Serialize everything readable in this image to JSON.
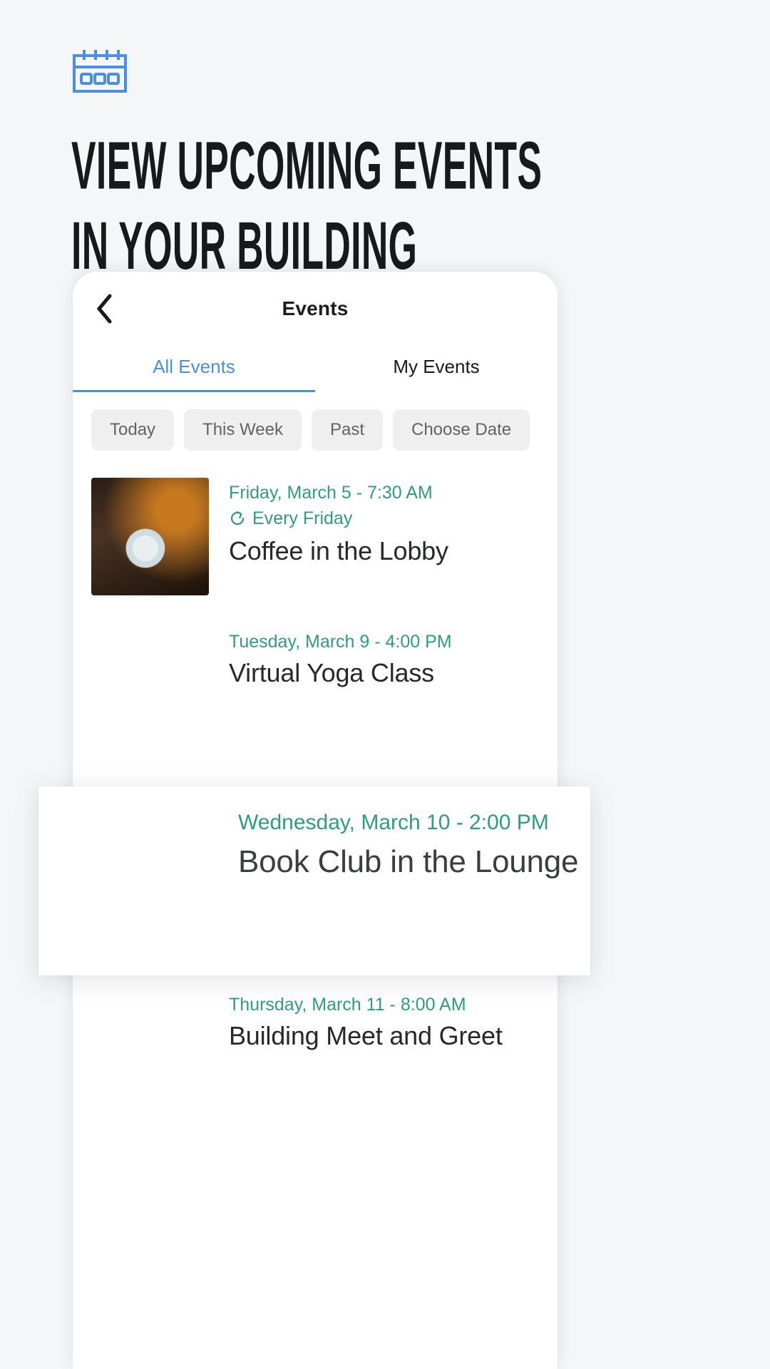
{
  "promo": {
    "icon": "calendar-icon",
    "icon_color": "#4a90e2",
    "headline": "VIEW UPCOMING EVENTS\nIN YOUR BUILDING"
  },
  "phone": {
    "nav": {
      "back_icon": "chevron-left-icon",
      "title": "Events"
    },
    "tabs": [
      {
        "label": "All Events",
        "active": true,
        "color": "#4a90e2"
      },
      {
        "label": "My Events",
        "active": false,
        "color": "#17191c"
      }
    ],
    "filters": [
      {
        "label": "Today"
      },
      {
        "label": "This Week"
      },
      {
        "label": "Past"
      },
      {
        "label": "Choose Date"
      }
    ],
    "events": [
      {
        "date": "Friday, March 5 - 7:30 AM",
        "repeat": "Every Friday",
        "repeat_icon": "repeat-icon",
        "title": "Coffee in the Lobby",
        "thumb": "coffee-cup-photo"
      },
      {
        "date": "Tuesday, March 9 - 4:00 PM",
        "repeat": "",
        "title": "Virtual Yoga Class",
        "thumb": "yoga-mats-photo"
      },
      {
        "date": "Thursday, March 11 - 8:00 AM",
        "repeat": "",
        "title": "Building Meet and Greet",
        "thumb": "people-smiling-photo"
      }
    ],
    "highlighted_event": {
      "date": "Wednesday, March 10 - 2:00 PM",
      "title": "Book Club in the Lounge",
      "thumb": "book-and-coffee-photo"
    }
  },
  "colors": {
    "page_background": "#f4f6f8",
    "accent_blue": "#4a90e2",
    "accent_green": "#2e9d7c",
    "chip_background": "#efeff0",
    "chip_text": "#5f6368",
    "title_text": "#17191c"
  }
}
